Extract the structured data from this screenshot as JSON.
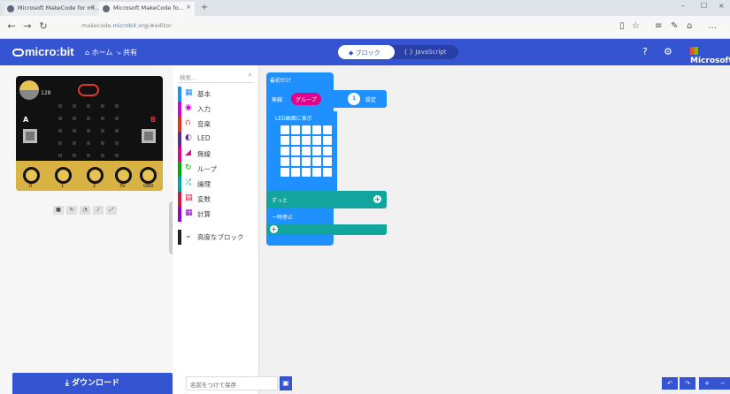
{
  "browser": {
    "tabs": [
      {
        "title": "Microsoft MakeCode for mi..."
      },
      {
        "title": "Microsoft MakeCode fo..."
      }
    ],
    "url_prefix": "makecode.",
    "url_host": "microbit.org",
    "url_suffix": "/#editor"
  },
  "header": {
    "logo_text": "micro:bit",
    "home_label": "ホーム",
    "share_label": "共有",
    "toggle_blocks": "ブロック",
    "toggle_js": "JavaScript",
    "ms_label": "Microsoft"
  },
  "simulator": {
    "light_value": "128",
    "pin_labels": [
      "0",
      "1",
      "2",
      "3V",
      "GND"
    ]
  },
  "toolbox": {
    "search_placeholder": "検索...",
    "categories": [
      {
        "label": "基本",
        "color": "#1e90ff",
        "icon": "grid-icon"
      },
      {
        "label": "入力",
        "color": "#d400d4",
        "icon": "input-icon"
      },
      {
        "label": "音楽",
        "color": "#e63022",
        "icon": "headphones-icon"
      },
      {
        "label": "LED",
        "color": "#5c2d91",
        "icon": "toggle-icon"
      },
      {
        "label": "無線",
        "color": "#e3008c",
        "icon": "signal-icon"
      },
      {
        "label": "ループ",
        "color": "#00aa00",
        "icon": "loop-icon"
      },
      {
        "label": "論理",
        "color": "#00a4a6",
        "icon": "shuffle-icon"
      },
      {
        "label": "変数",
        "color": "#dc143c",
        "icon": "list-icon"
      },
      {
        "label": "計算",
        "color": "#9400d3",
        "icon": "calculator-icon"
      },
      {
        "label": "高度なブロック",
        "color": "#333333",
        "icon": "chevron-down-icon"
      }
    ]
  },
  "workspace": {
    "start_label": "最初だけ",
    "radio_left": "無線",
    "radio_pill": "グループ",
    "radio_value": "1",
    "radio_right": "設定",
    "show_leds_label": "LED画面に表示",
    "forever_label": "ずっと",
    "pause_label": "一時停止"
  },
  "bottom": {
    "download_label": "ダウンロード",
    "project_name": "名前をつけて保存"
  }
}
